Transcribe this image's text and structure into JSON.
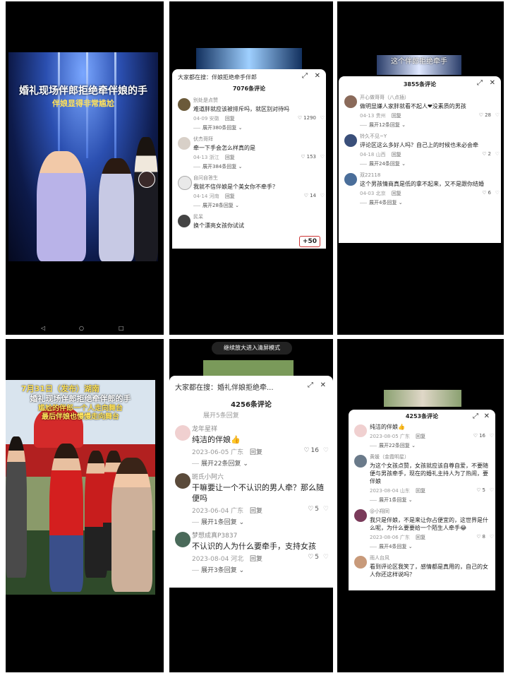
{
  "panel1": {
    "caption_main": "婚礼现场伴郎拒绝牵伴娘的手",
    "caption_sub": "伴娘显得非常尴尬"
  },
  "panel2": {
    "search_label": "大家都在搜：伴娘拒绝牵手伴郎",
    "comment_count": "7076条评论",
    "badge": "+50",
    "comments": [
      {
        "user": "别处是点赞",
        "text": "难道胖就应该被排斥吗，就区别对待吗",
        "date": "04-09 安徽",
        "reply": "回复",
        "likes": "1290",
        "expand": "展开380条回复"
      },
      {
        "user": "伏杰哥拜",
        "text": "牵一下手会怎么样真的是",
        "date": "04-13 浙江",
        "reply": "回复",
        "likes": "153",
        "expand": "展开384条回复"
      },
      {
        "user": "自问自答生",
        "text": "我就不信伴娘是个美女你不牵手？",
        "date": "04-14 河南",
        "reply": "回复",
        "likes": "14",
        "expand": "展开28条回复"
      },
      {
        "user": "民呆",
        "text": "换个漂亮女孩你试试",
        "date": "",
        "reply": "",
        "likes": "",
        "expand": ""
      }
    ]
  },
  "panel3": {
    "top_caption": "这个伴郎拒绝牵手",
    "comment_count": "3855条评论",
    "comments": [
      {
        "user": "开心做哥哥（八点插）",
        "text": "做明显嫌人家胖就看不起人❤没素质的男孩",
        "date": "04-13 贵州",
        "reply": "回复",
        "likes": "28",
        "expand": "展开12条回复"
      },
      {
        "user": "铃久不见~Y",
        "text": "评论区这么多好人吗？自己上的时候也未必会牵",
        "date": "04-18 山西",
        "reply": "回复",
        "likes": "2",
        "expand": "展开24条回复"
      },
      {
        "user": "双22118",
        "text": "这个男孩情商真是低的拿不起来，又不是跟你结婚",
        "date": "04-03 北京",
        "reply": "回复",
        "likes": "6",
        "expand": "展开4条回复"
      }
    ]
  },
  "panel4": {
    "caption_line1": "7月31日（发布）湖南",
    "caption_line2": "婚礼现场伴郎拒绝牵伴郎的手",
    "caption_line3": "尴尬的伴郎一个人走向舞台",
    "caption_line4": "最后伴娘也慢慢走向舞台"
  },
  "panel5": {
    "tip": "继续放大进入清屏模式",
    "search_label": "大家都在搜：婚礼伴娘拒绝牵...",
    "comment_count": "4256条评论",
    "hidden_expand": "展开5条回复",
    "comments": [
      {
        "user": "龙年星祥",
        "text": "纯洁的伴娘👍",
        "date": "2023-06-05 广东",
        "reply": "回复",
        "likes": "16",
        "expand": "展开22条回复"
      },
      {
        "user": "斑氏小阿六",
        "text": "干嘛要让一个不认识的男人牵？那么随便吗",
        "date": "2023-06-04 广东",
        "reply": "回复",
        "likes": "5",
        "expand": "展开1条回复"
      },
      {
        "user": "梦想成真P3837",
        "text": "不认识的人为什么要牵手，支持女孩",
        "date": "2023-08-04 河北",
        "reply": "回复",
        "likes": "5",
        "expand": "展开3条回复"
      }
    ]
  },
  "panel6": {
    "comment_count": "4253条评论",
    "comments": [
      {
        "user": "",
        "text": "纯洁的伴娘👍",
        "date": "2023-08-05 广东",
        "reply": "回复",
        "likes": "16",
        "expand": "展开22条回复"
      },
      {
        "user": "黄媛（金霞明星）",
        "text": "为这个女孩点赞，女孩就应该自尊自爱，不要随便与男孩牵手，现在的婚礼主持人为了热闹，要伴娘",
        "date": "2023-08-04 山东",
        "reply": "回复",
        "likes": "5",
        "expand": "展开1条回复"
      },
      {
        "user": "@小翔同",
        "text": "我只是伴娘，不是来让你占便宜的，这世界是什么呢，为什么要要给一个陌生人牵手😂",
        "date": "2023-08-06 广东",
        "reply": "回复",
        "likes": "8",
        "expand": "展开4条回复"
      },
      {
        "user": "雨人台风",
        "text": "看到评论区我笑了，感情都是真用的，自己的女人你还这样说吗？",
        "date": "",
        "reply": "",
        "likes": "",
        "expand": ""
      }
    ]
  }
}
